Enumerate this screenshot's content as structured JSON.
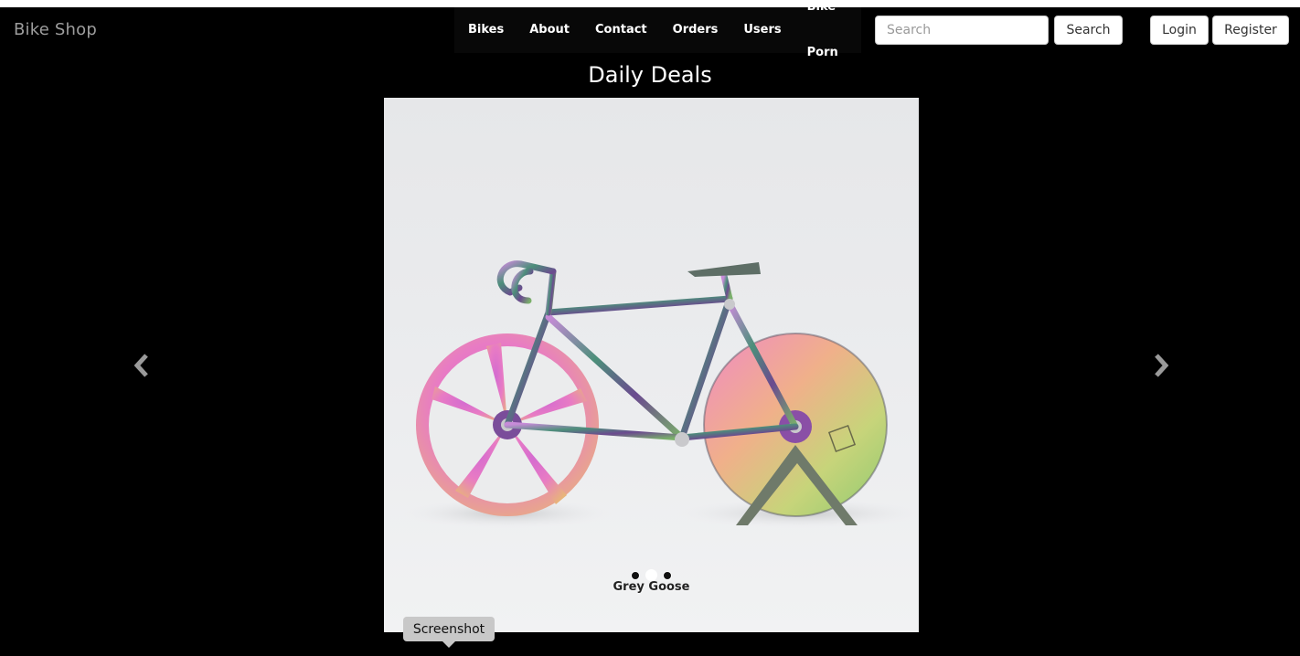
{
  "navbar": {
    "brand": "Bike Shop",
    "links": [
      "Bikes",
      "About",
      "Contact",
      "Orders",
      "Users",
      "Bike Porn"
    ],
    "search": {
      "placeholder": "Search",
      "value": "",
      "button_label": "Search"
    },
    "login_label": "Login",
    "register_label": "Register"
  },
  "main": {
    "title": "Daily Deals",
    "carousel": {
      "caption": "Grey Goose",
      "slide_count": 3,
      "active_index": 1,
      "prev_icon": "chevron-left-icon",
      "next_icon": "chevron-right-icon"
    }
  },
  "tooltip": {
    "label": "Screenshot"
  },
  "colors": {
    "background": "#000000",
    "brand_text": "#9d9d9d",
    "nav_bg": "#080808",
    "slide_bg": "#e9eaec"
  }
}
